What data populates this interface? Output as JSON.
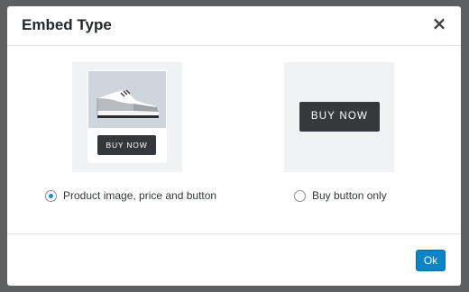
{
  "modal": {
    "title": "Embed Type",
    "close_icon": "×"
  },
  "options": [
    {
      "id": "product-image-price-button",
      "label": "Product image, price and button",
      "selected": true,
      "preview": {
        "image_icon": "sneaker-image",
        "button_label": "BUY NOW"
      }
    },
    {
      "id": "buy-button-only",
      "label": "Buy button only",
      "selected": false,
      "preview": {
        "button_label": "BUY NOW"
      }
    }
  ],
  "footer": {
    "ok_label": "Ok"
  },
  "colors": {
    "accent": "#0e84c8",
    "radio_selected": "#1e8cbe",
    "buy_button": "#35383c",
    "preview_bg": "#f1f2f4",
    "overlay": "#5d5f61"
  }
}
